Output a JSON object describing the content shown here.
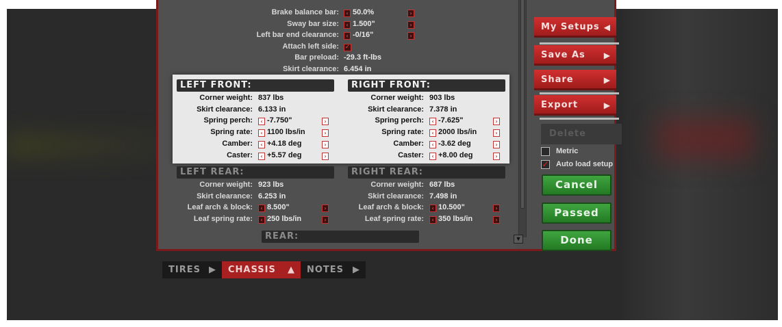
{
  "top_rows": [
    {
      "label": "Brake balance bar:",
      "value": "50.0%",
      "type": "adjust"
    },
    {
      "label": "Sway bar size:",
      "value": "1.500\"",
      "type": "adjust"
    },
    {
      "label": "Left bar end clearance:",
      "value": "-0/16\"",
      "type": "adjust"
    },
    {
      "label": "Attach left side:",
      "value": "✓",
      "type": "checkbox"
    },
    {
      "label": "Bar preload:",
      "value": "-29.3 ft-lbs",
      "type": "static"
    },
    {
      "label": "Skirt clearance:",
      "value": "6.454 in",
      "type": "static"
    }
  ],
  "left_front": {
    "title": "LEFT FRONT:",
    "rows": [
      {
        "label": "Corner weight:",
        "value": "837 lbs",
        "adjust": false
      },
      {
        "label": "Skirt clearance:",
        "value": "6.133 in",
        "adjust": false
      },
      {
        "label": "Spring perch:",
        "value": "-7.750\"",
        "adjust": true
      },
      {
        "label": "Spring rate:",
        "value": "1100 lbs/in",
        "adjust": true
      },
      {
        "label": "Camber:",
        "value": "+4.18 deg",
        "adjust": true
      },
      {
        "label": "Caster:",
        "value": "+5.57 deg",
        "adjust": true
      }
    ]
  },
  "right_front": {
    "title": "RIGHT FRONT:",
    "rows": [
      {
        "label": "Corner weight:",
        "value": "903 lbs",
        "adjust": false
      },
      {
        "label": "Skirt clearance:",
        "value": "7.378 in",
        "adjust": false
      },
      {
        "label": "Spring perch:",
        "value": "-7.625\"",
        "adjust": true
      },
      {
        "label": "Spring rate:",
        "value": "2000 lbs/in",
        "adjust": true
      },
      {
        "label": "Camber:",
        "value": "-3.62 deg",
        "adjust": true
      },
      {
        "label": "Caster:",
        "value": "+8.00 deg",
        "adjust": true
      }
    ]
  },
  "left_rear": {
    "title": "LEFT REAR:",
    "rows": [
      {
        "label": "Corner weight:",
        "value": "923 lbs",
        "adjust": false
      },
      {
        "label": "Skirt clearance:",
        "value": "6.253 in",
        "adjust": false
      },
      {
        "label": "Leaf arch & block:",
        "value": "8.500\"",
        "adjust": true
      },
      {
        "label": "Leaf spring rate:",
        "value": "250 lbs/in",
        "adjust": true
      }
    ]
  },
  "right_rear": {
    "title": "RIGHT REAR:",
    "rows": [
      {
        "label": "Corner weight:",
        "value": "687 lbs",
        "adjust": false
      },
      {
        "label": "Skirt clearance:",
        "value": "7.498 in",
        "adjust": false
      },
      {
        "label": "Leaf arch & block:",
        "value": "10.500\"",
        "adjust": true
      },
      {
        "label": "Leaf spring rate:",
        "value": "350 lbs/in",
        "adjust": true
      }
    ]
  },
  "rear": {
    "title": "REAR:"
  },
  "side_buttons": {
    "my_setups": "My Setups",
    "save_as": "Save As",
    "share": "Share",
    "export": "Export",
    "delete": "Delete"
  },
  "options": {
    "metric": {
      "label": "Metric",
      "checked": false
    },
    "auto_load": {
      "label": "Auto load setup",
      "checked": true
    }
  },
  "action_buttons": {
    "cancel": "Cancel",
    "passed": "Passed",
    "done": "Done"
  },
  "tabs": [
    {
      "label": "TIRES",
      "active": false
    },
    {
      "label": "CHASSIS",
      "active": true
    },
    {
      "label": "NOTES",
      "active": false
    }
  ],
  "colors": {
    "accent_red": "#a82020",
    "green": "#2e8f2e",
    "panel": "#505050"
  }
}
